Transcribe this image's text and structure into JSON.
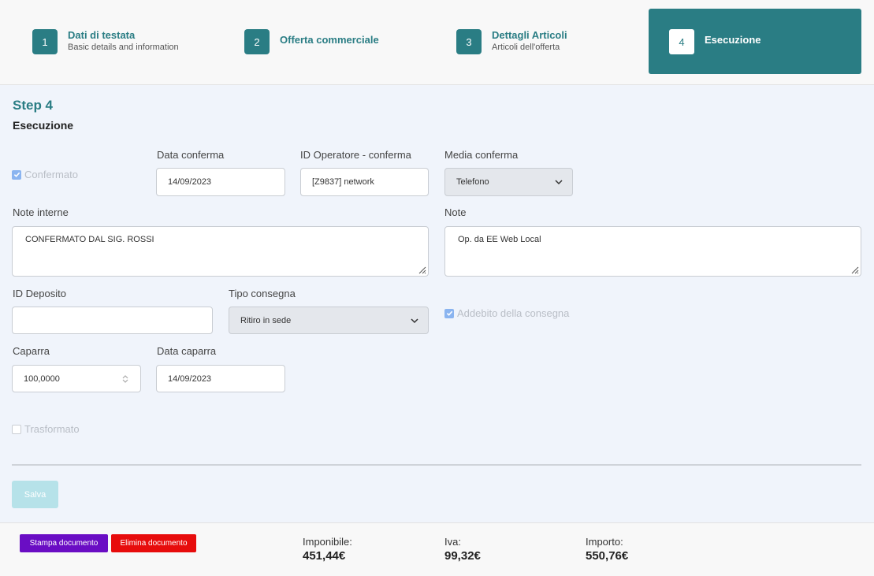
{
  "stepper": {
    "steps": [
      {
        "number": "1",
        "title": "Dati di testata",
        "subtitle": "Basic details and information"
      },
      {
        "number": "2",
        "title": "Offerta commerciale",
        "subtitle": ""
      },
      {
        "number": "3",
        "title": "Dettagli Articoli",
        "subtitle": "Articoli dell'offerta"
      },
      {
        "number": "4",
        "title": "Esecuzione",
        "subtitle": ""
      }
    ],
    "active_step": "4"
  },
  "page": {
    "step_heading": "Step 4",
    "step_subheading": "Esecuzione"
  },
  "form": {
    "confermato": {
      "label": "Confermato",
      "checked": true
    },
    "data_conferma": {
      "label": "Data conferma",
      "value": "14/09/2023"
    },
    "id_operatore": {
      "label": "ID Operatore - conferma",
      "value": "[Z9837] network"
    },
    "media_conferma": {
      "label": "Media conferma",
      "value": "Telefono"
    },
    "note_interne": {
      "label": "Note interne",
      "value": "CONFERMATO DAL SIG. ROSSI"
    },
    "note": {
      "label": "Note",
      "value": "Op. da EE Web Local"
    },
    "id_deposito": {
      "label": "ID Deposito",
      "value": ""
    },
    "tipo_consegna": {
      "label": "Tipo consegna",
      "value": "Ritiro in sede"
    },
    "addebito_consegna": {
      "label": "Addebito della consegna",
      "checked": true
    },
    "caparra": {
      "label": "Caparra",
      "value": "100,0000"
    },
    "data_caparra": {
      "label": "Data caparra",
      "value": "14/09/2023"
    },
    "trasformato": {
      "label": "Trasformato",
      "checked": false
    },
    "save_label": "Salva"
  },
  "footer": {
    "print_label": "Stampa documento",
    "delete_label": "Elimina documento",
    "imponibile_label": "Imponibile:",
    "imponibile_value": "451,44€",
    "iva_label": "Iva:",
    "iva_value": "99,32€",
    "importo_label": "Importo:",
    "importo_value": "550,76€"
  },
  "colors": {
    "accent": "#2a7d84",
    "print_button": "#6a0dc4",
    "delete_button": "#e70c0c",
    "save_button_disabled": "#b6e2e9",
    "checkbox_checked": "#8ab4f0"
  },
  "icons": {
    "select_arrow": "chevron-down-icon",
    "checkbox_mark": "check-icon",
    "resize_handle": "resize-grip-icon",
    "number_spinner": "spinner-arrows-icon"
  }
}
